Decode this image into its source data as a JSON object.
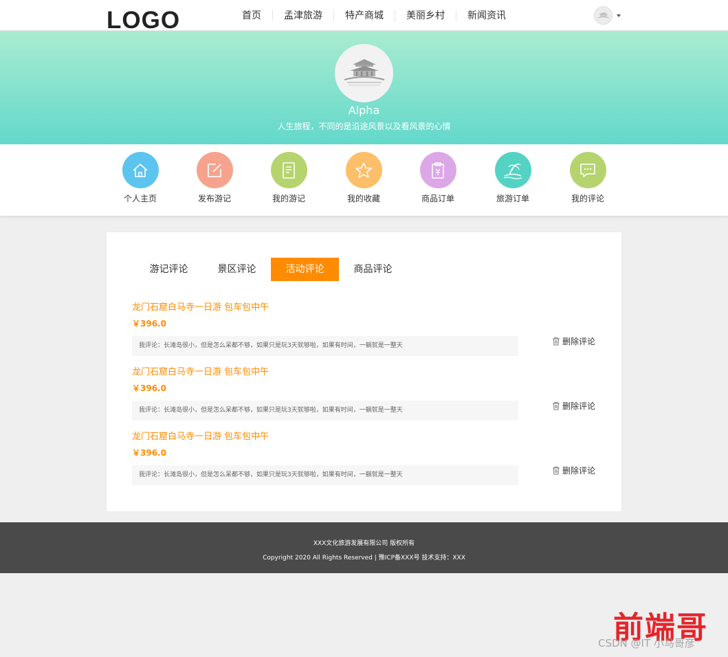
{
  "header": {
    "logo": "LOGO",
    "nav": [
      "首页",
      "孟津旅游",
      "特产商城",
      "美丽乡村",
      "新闻资讯"
    ]
  },
  "profile": {
    "name": "Alpha",
    "motto": "人生旅程，不同的是沿途风景以及看风景的心情"
  },
  "menu": [
    {
      "label": "个人主页",
      "icon": "home-icon",
      "color": "#5cc4ee"
    },
    {
      "label": "发布游记",
      "icon": "edit-icon",
      "color": "#f6a38e"
    },
    {
      "label": "我的游记",
      "icon": "document-icon",
      "color": "#b5d46e"
    },
    {
      "label": "我的收藏",
      "icon": "star-icon",
      "color": "#fdbf69"
    },
    {
      "label": "商品订单",
      "icon": "clipboard-yen-icon",
      "color": "#dca7e6"
    },
    {
      "label": "旅游订单",
      "icon": "beach-island-icon",
      "color": "#54d3c4"
    },
    {
      "label": "我的评论",
      "icon": "chat-bubble-icon",
      "color": "#b5d46e"
    }
  ],
  "tabs": [
    {
      "label": "游记评论",
      "active": false
    },
    {
      "label": "景区评论",
      "active": false
    },
    {
      "label": "活动评论",
      "active": true
    },
    {
      "label": "商品评论",
      "active": false
    }
  ],
  "comments": [
    {
      "title": "龙门石窟白马寺一日游 包车包中午",
      "price": "￥396.0",
      "text": "我评论：长滩岛很小，但是怎么呆都不够，如果只是玩3天就够啦，如果有时间，一躺就是一整天",
      "delete_label": "删除评论"
    },
    {
      "title": "龙门石窟白马寺一日游 包车包中午",
      "price": "￥396.0",
      "text": "我评论：长滩岛很小，但是怎么呆都不够，如果只是玩3天就够啦，如果有时间，一躺就是一整天",
      "delete_label": "删除评论"
    },
    {
      "title": "龙门石窟白马寺一日游 包车包中午",
      "price": "￥396.0",
      "text": "我评论：长滩岛很小，但是怎么呆都不够，如果只是玩3天就够啦，如果有时间，一躺就是一整天",
      "delete_label": "删除评论"
    }
  ],
  "footer": {
    "line1": "XXX文化旅游发展有限公司 版权所有",
    "line2": "Copyright 2020 All Rights Reserved | 豫ICP备XXX号    技术支持：XXX"
  },
  "watermark": {
    "brand": "前端哥",
    "credit": "CSDN @IT 小马哥彦"
  },
  "colors": {
    "accent": "#ff8b00",
    "banner_top": "#a9ecd0",
    "banner_bottom": "#63d8cb",
    "footer_bg": "#4a4a4a"
  }
}
